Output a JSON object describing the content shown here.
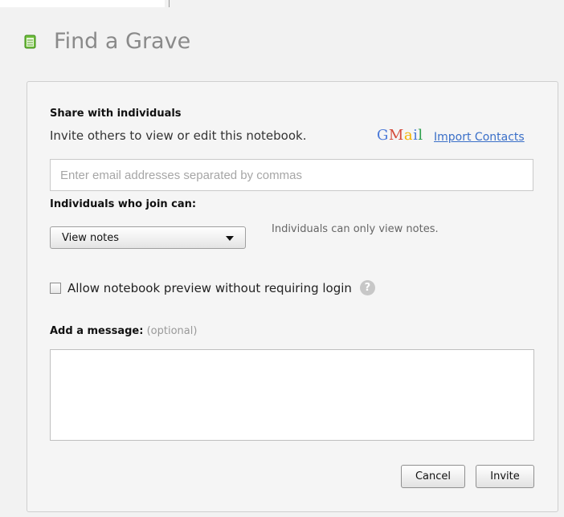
{
  "header": {
    "title": "Find a Grave",
    "icon": "notebook-icon",
    "icon_color": "#6fbf3a"
  },
  "share": {
    "heading": "Share with individuals",
    "subheading": "Invite others to view or edit this notebook.",
    "gmail_logo": "Gmail",
    "import_link": "Import Contacts",
    "email_placeholder": "Enter email addresses separated by commas",
    "email_value": ""
  },
  "permissions": {
    "heading": "Individuals who join can:",
    "selected": "View notes",
    "note": "Individuals can only view notes."
  },
  "preview": {
    "label": "Allow notebook preview without requiring login",
    "checked": false,
    "help_icon": "help-icon"
  },
  "message": {
    "label": "Add a message:",
    "optional": "(optional)",
    "value": ""
  },
  "buttons": {
    "cancel": "Cancel",
    "invite": "Invite"
  },
  "colors": {
    "link": "#3a6fc8",
    "title": "#8a8a8a"
  }
}
